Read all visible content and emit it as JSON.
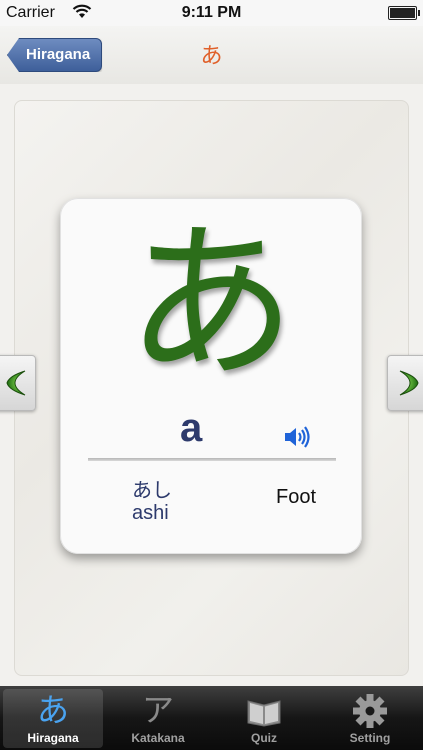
{
  "status": {
    "carrier": "Carrier",
    "time": "9:11 PM"
  },
  "nav": {
    "back_label": "Hiragana",
    "title": "あ"
  },
  "card": {
    "character": "あ",
    "romaji": "a",
    "example_kana": "あし",
    "example_romaji": "ashi",
    "example_meaning": "Foot"
  },
  "tabs": [
    {
      "label": "Hiragana",
      "icon": "hiragana-a-icon",
      "glyph": "あ",
      "active": true
    },
    {
      "label": "Katakana",
      "icon": "katakana-a-icon",
      "glyph": "ア",
      "active": false
    },
    {
      "label": "Quiz",
      "icon": "book-icon",
      "active": false
    },
    {
      "label": "Setting",
      "icon": "gear-icon",
      "active": false
    }
  ],
  "colors": {
    "accent_title": "#e0602a",
    "character_green": "#2c6e1a",
    "text_blue": "#2d3a6c",
    "back_button": "#4a6aa5"
  }
}
